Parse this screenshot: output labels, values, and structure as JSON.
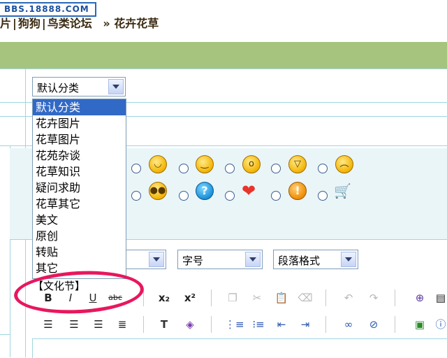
{
  "header": {
    "watermark": "BBS.18888.COM",
    "breadcrumb": {
      "part1": "片",
      "part2": "狗狗",
      "part3": "鸟类论坛",
      "arrow": "»",
      "current": "花卉花草"
    }
  },
  "category_select": {
    "selected": "默认分类",
    "options": [
      "默认分类",
      "花卉图片",
      "花草图片",
      "花苑杂谈",
      "花草知识",
      "疑问求助",
      "花草其它",
      "美文",
      "原创",
      "转贴",
      "其它"
    ],
    "custom_option": "【文化节】"
  },
  "toolbar": {
    "font_size_label": "字号",
    "paragraph_label": "段落格式",
    "icons": {
      "subscript": "x₂",
      "superscript": "x²"
    }
  },
  "smileys": [
    "smile-face-icon",
    "grin-face-icon",
    "surprised-face-icon",
    "laugh-face-icon",
    "angry-face-icon",
    "cool-face-icon",
    "question-icon",
    "heart-icon",
    "exclamation-icon",
    "cart-icon"
  ],
  "colors": {
    "header_bar": "#a7c47e",
    "highlight": "#3169c6",
    "annotation_circle": "#e8175d"
  }
}
